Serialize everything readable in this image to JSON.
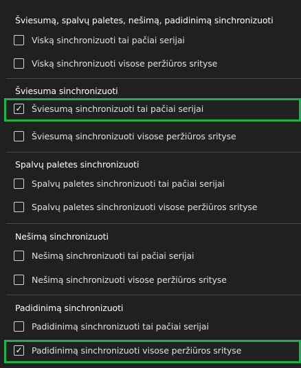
{
  "sections": [
    {
      "title": "Šviesumą, spalvų paletes, nešimą, padidinimą sinchronizuoti",
      "options": [
        {
          "label": "Viską sinchronizuoti tai pačiai serijai",
          "checked": false
        },
        {
          "label": "Viską sinchronizuoti visose peržiūros srityse",
          "checked": false
        }
      ]
    },
    {
      "title": "Šviesuma sinchronizuoti",
      "options": [
        {
          "label": "Šviesumą sinchronizuoti tai pačiai serijai",
          "checked": true
        },
        {
          "label": "Šviesumą sinchronizuoti visose peržiūros srityse",
          "checked": false
        }
      ]
    },
    {
      "title": "Spalvų paletes sinchronizuoti",
      "options": [
        {
          "label": "Spalvų paletes sinchronizuoti tai pačiai serijai",
          "checked": false
        },
        {
          "label": "Spalvų paletes sinchronizuoti visose peržiūros srityse",
          "checked": false
        }
      ]
    },
    {
      "title": "Nešimą sinchronizuoti",
      "options": [
        {
          "label": "Nešimą sinchronizuoti tai pačiai serijai",
          "checked": false
        },
        {
          "label": "Nešimą sinchronizuoti visose peržiūros srityse",
          "checked": false
        }
      ]
    },
    {
      "title": "Padidinimą sinchronizuoti",
      "options": [
        {
          "label": "Padidinimą sinchronizuoti tai pačiai serijai",
          "checked": false
        },
        {
          "label": "Padidinimą sinchronizuoti visose peržiūros srityse",
          "checked": true
        }
      ]
    }
  ],
  "check_glyph": "✓",
  "colors": {
    "background": "#202020",
    "selected_outline": "#1db24a",
    "divider": "#4a4a4a"
  }
}
